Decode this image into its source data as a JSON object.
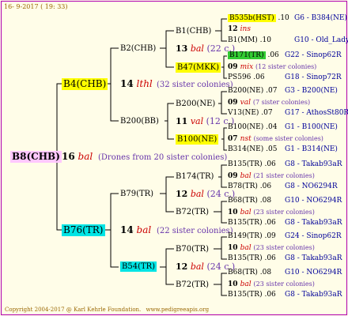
{
  "header": {
    "date": "16- 9-2017 ( 19: 33)"
  },
  "footer": {
    "copyright": "Copyright 2004-2017 @ Karl Kehrle Foundation.",
    "website": "www.pedigreeapis.org"
  },
  "root": {
    "label": "B8(CHB)",
    "gen": "16",
    "race": "bal",
    "desc": "(Drones from 20 sister colonies)"
  },
  "sire": {
    "label": "B4(CHB)",
    "gen": "14",
    "race": "lthl",
    "desc": "(32 sister colonies)"
  },
  "dam": {
    "label": "B76(TR)",
    "gen": "14",
    "race": "bal",
    "desc": "(22 sister colonies)"
  },
  "g3": {
    "b2": {
      "label": "B2(CHB)"
    },
    "b200bb": {
      "label": "B200(BB)"
    },
    "b79": {
      "label": "B79(TR)"
    },
    "b54": {
      "label": "B54(TR)"
    }
  },
  "g4": {
    "b1chb": {
      "label": "B1(CHB)",
      "gen": "13",
      "race": "bal",
      "desc": "(22 c.)"
    },
    "b47": {
      "label": "B47(MKK)"
    },
    "b200ne": {
      "label": "B200(NE)",
      "gen": "11",
      "race": "val",
      "desc": "(12 c.)"
    },
    "b100": {
      "label": "B100(NE)"
    },
    "b174": {
      "label": "B174(TR)",
      "gen": "12",
      "race": "bal",
      "desc": "(24 c.)"
    },
    "b72a": {
      "label": "B72(TR)"
    },
    "b70": {
      "label": "B70(TR)",
      "gen": "12",
      "race": "bal",
      "desc": "(24 c.)"
    },
    "b72b": {
      "label": "B72(TR)"
    }
  },
  "g5": [
    {
      "name": "B535b(HST)",
      "num": ".10",
      "ref": "G6 - B384(NE)"
    },
    {
      "gen": "12",
      "race": "ins"
    },
    {
      "name": "B1(MM)",
      "num": ".10",
      "ref": "G10 - Old_Lady"
    },
    {
      "name": "B171(TR)",
      "num": ".06",
      "ref": "G22 - Sinop62R"
    },
    {
      "gen": "09",
      "race": "mix",
      "desc": "(12 sister colonies)"
    },
    {
      "name": "PS596",
      "num": ".06",
      "ref": "G18 - Sinop72R"
    },
    {
      "name": "B200(NE)",
      "num": ".07",
      "ref": "G3 - B200(NE)"
    },
    {
      "gen": "09",
      "race": "val",
      "desc": "(7 sister colonies)"
    },
    {
      "name": "V13(NE)",
      "num": ".07",
      "ref": "G17 - AthosSt80R"
    },
    {
      "name": "B100(NE)",
      "num": ".04",
      "ref": "G1 - B100(NE)"
    },
    {
      "gen": "07",
      "race": "nst",
      "desc": "(some sister colonies)"
    },
    {
      "name": "B314(NE)",
      "num": ".05",
      "ref": "G1 - B314(NE)"
    },
    {
      "name": "B135(TR)",
      "num": ".06",
      "ref": "G8 - Takab93aR"
    },
    {
      "gen": "09",
      "race": "bal",
      "desc": "(21 sister colonies)"
    },
    {
      "name": "B78(TR)",
      "num": ".06",
      "ref": "G8 - NO6294R"
    },
    {
      "name": "B68(TR)",
      "num": ".08",
      "ref": "G10 - NO6294R"
    },
    {
      "gen": "10",
      "race": "bal",
      "desc": "(23 sister colonies)"
    },
    {
      "name": "B135(TR)",
      "num": ".06",
      "ref": "G8 - Takab93aR"
    },
    {
      "name": "B149(TR)",
      "num": ".09",
      "ref": "G24 - Sinop62R"
    },
    {
      "gen": "10",
      "race": "bal",
      "desc": "(23 sister colonies)"
    },
    {
      "name": "B135(TR)",
      "num": ".06",
      "ref": "G8 - Takab93aR"
    },
    {
      "name": "B68(TR)",
      "num": ".08",
      "ref": "G10 - NO6294R"
    },
    {
      "gen": "10",
      "race": "bal",
      "desc": "(23 sister colonies)"
    },
    {
      "name": "B135(TR)",
      "num": ".06",
      "ref": "G8 - Takab93aR"
    }
  ]
}
